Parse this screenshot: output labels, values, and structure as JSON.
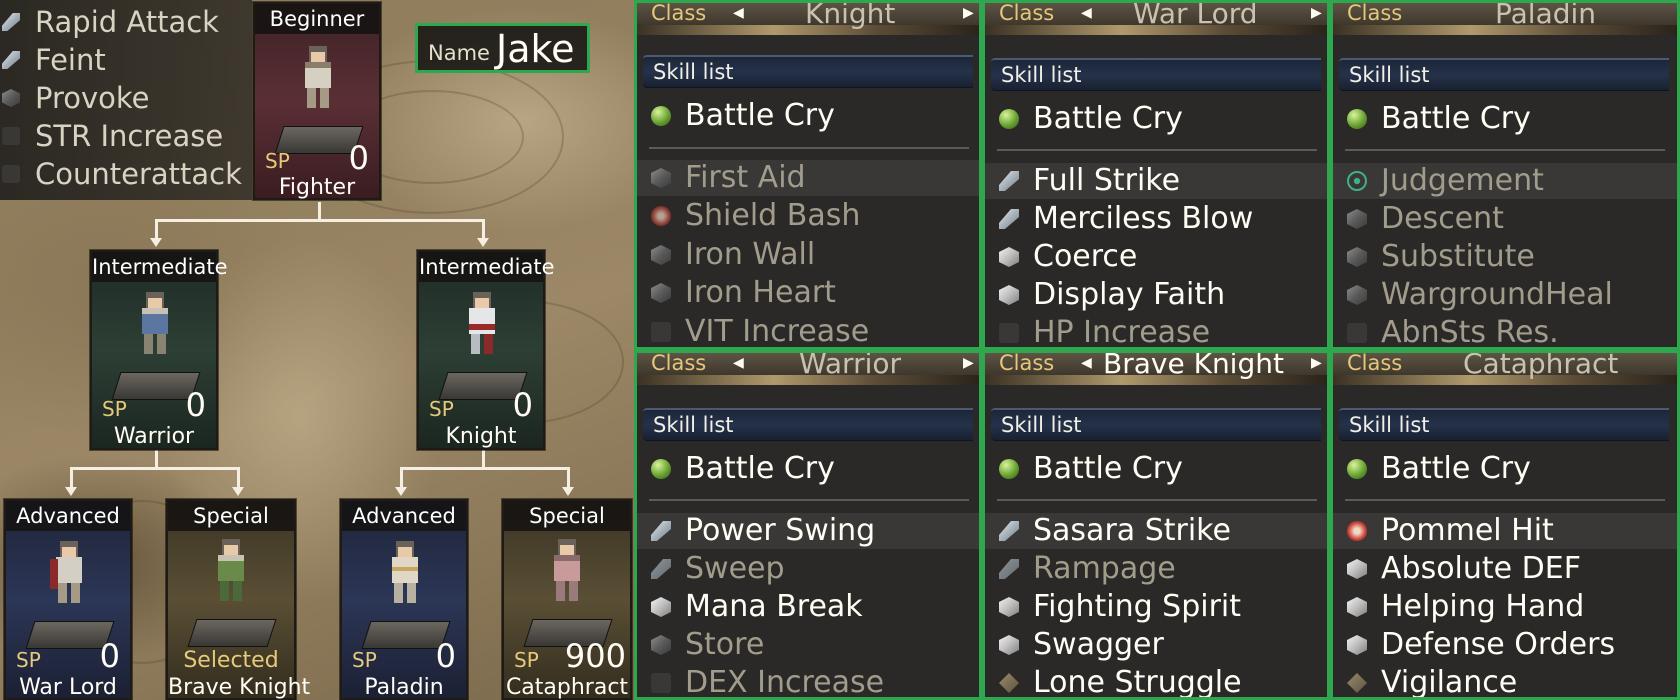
{
  "character": {
    "name_label": "Name",
    "name": "Jake"
  },
  "current_skills": [
    {
      "label": "Rapid Attack",
      "icon": "sword-icon"
    },
    {
      "label": "Feint",
      "icon": "sword-icon"
    },
    {
      "label": "Provoke",
      "icon": "cube-icon"
    },
    {
      "label": "STR Increase",
      "icon": "passive-icon"
    },
    {
      "label": "Counterattack",
      "icon": "passive-icon"
    }
  ],
  "tree": {
    "sp_label": "SP",
    "selected_label": "Selected",
    "beginner": {
      "tier": "Beginner",
      "class": "Fighter",
      "sp": "0"
    },
    "warrior": {
      "tier": "Intermediate",
      "class": "Warrior",
      "sp": "0"
    },
    "knight": {
      "tier": "Intermediate",
      "class": "Knight",
      "sp": "0"
    },
    "war_lord": {
      "tier": "Advanced",
      "class": "War Lord",
      "sp": "0"
    },
    "brave_knight": {
      "tier": "Special",
      "class": "Brave Knight"
    },
    "paladin": {
      "tier": "Advanced",
      "class": "Paladin",
      "sp": "0"
    },
    "cataphract": {
      "tier": "Special",
      "class": "Cataphract",
      "sp": "900"
    }
  },
  "panels": {
    "class_label": "Class",
    "skill_list_label": "Skill list",
    "knight": {
      "class_name": "Knight",
      "top": "Battle Cry",
      "skills": [
        "First Aid",
        "Shield Bash",
        "Iron Wall",
        "Iron Heart",
        "VIT Increase"
      ]
    },
    "war_lord": {
      "class_name": "War Lord",
      "top": "Battle Cry",
      "skills": [
        "Full Strike",
        "Merciless Blow",
        "Coerce",
        "Display Faith",
        "HP Increase"
      ]
    },
    "paladin": {
      "class_name": "Paladin",
      "top": "Battle Cry",
      "skills": [
        "Judgement",
        "Descent",
        "Substitute",
        "WargroundHeal",
        "AbnSts Res."
      ]
    },
    "warrior": {
      "class_name": "Warrior",
      "top": "Battle Cry",
      "skills": [
        "Power Swing",
        "Sweep",
        "Mana Break",
        "Store",
        "DEX Increase"
      ]
    },
    "brave_knight": {
      "class_name": "Brave Knight",
      "top": "Battle Cry",
      "skills": [
        "Sasara Strike",
        "Rampage",
        "Fighting Spirit",
        "Swagger",
        "Lone Struggle"
      ]
    },
    "cataphract": {
      "class_name": "Cataphract",
      "top": "Battle Cry",
      "skills": [
        "Pommel Hit",
        "Absolute DEF",
        "Helping Hand",
        "Defense Orders",
        "Vigilance"
      ]
    }
  },
  "colors": {
    "highlight_border": "#2ea84f",
    "sp_gold": "#e7c97a"
  }
}
